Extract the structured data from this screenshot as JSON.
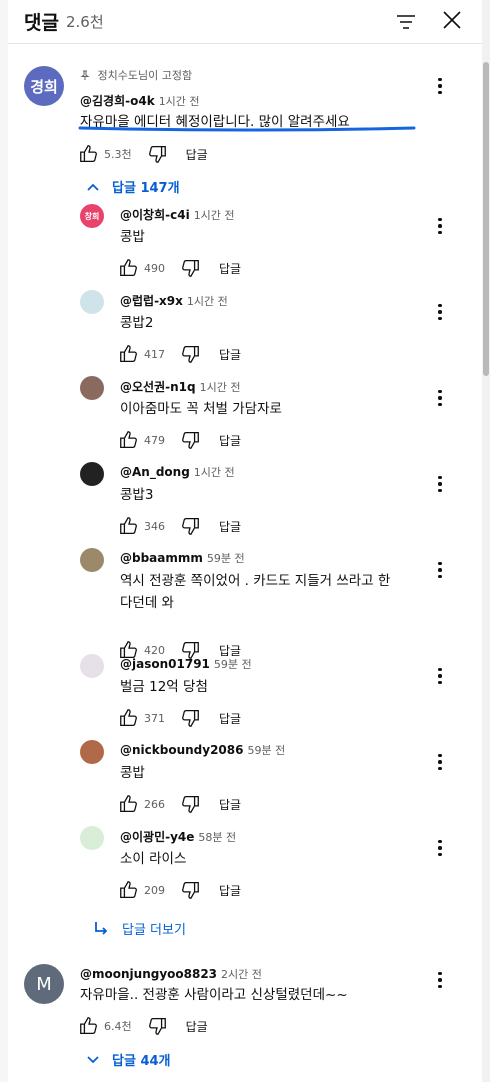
{
  "header": {
    "title": "댓글",
    "count": "2.6천"
  },
  "pinned": {
    "avatar_text": "경희",
    "pinned_by": "정치수도님이 고정함",
    "author": "@김경희-o4k",
    "time": "1시간 전",
    "text": "자유마을 에디터 혜정이랍니다.  많이  알려주세요",
    "likes": "5.3천",
    "reply_label": "답글",
    "replies_toggle": "답글 147개"
  },
  "replies": [
    {
      "avatar_text": "창희",
      "author": "@이창희-c4i",
      "time": "1시간 전",
      "text": "콩밥",
      "likes": "490",
      "reply_label": "답글"
    },
    {
      "author": "@럽럽-x9x",
      "time": "1시간 전",
      "text": "콩밥2",
      "likes": "417",
      "reply_label": "답글"
    },
    {
      "author": "@오선권-n1q",
      "time": "1시간 전",
      "text": "이아줌마도 꼭 처벌 가담자로",
      "likes": "479",
      "reply_label": "답글"
    },
    {
      "author": "@An_dong",
      "time": "1시간 전",
      "text": "콩밥3",
      "likes": "346",
      "reply_label": "답글"
    },
    {
      "author": "@bbaammm",
      "time": "59분 전",
      "text_line1": "역시 전광훈 쪽이었어 . 카드도 지들거 쓰라고 한",
      "text_line2": "다던데 와",
      "likes": "420",
      "reply_label": "답글"
    },
    {
      "author": "@jason01791",
      "time": "59분 전",
      "text": "벌금 12억 당첨",
      "likes": "371",
      "reply_label": "답글"
    },
    {
      "author": "@nickboundy2086",
      "time": "59분 전",
      "text": "콩밥",
      "likes": "266",
      "reply_label": "답글"
    },
    {
      "author": "@이광민-y4e",
      "time": "58분 전",
      "text": "소이 라이스",
      "likes": "209",
      "reply_label": "답글"
    }
  ],
  "more_replies_label": "답글 더보기",
  "second": {
    "avatar_text": "M",
    "author": "@moonjungyoo8823",
    "time": "2시간 전",
    "text": "자유마을.. 전광훈 사람이라고 신상털렸던데~~",
    "likes": "6.4천",
    "reply_label": "답글",
    "replies_toggle": "답글 44개"
  },
  "colors": {
    "link_blue": "#065fd4",
    "pinned_avatar": "#5c6bc0",
    "second_avatar": "#5f6b7a"
  },
  "icons": [
    "sort-icon",
    "close-icon",
    "pin-icon",
    "thumb-up-icon",
    "thumb-down-icon",
    "chevron-up-icon",
    "chevron-down-icon",
    "reply-arrow-icon",
    "more-vert-icon"
  ]
}
